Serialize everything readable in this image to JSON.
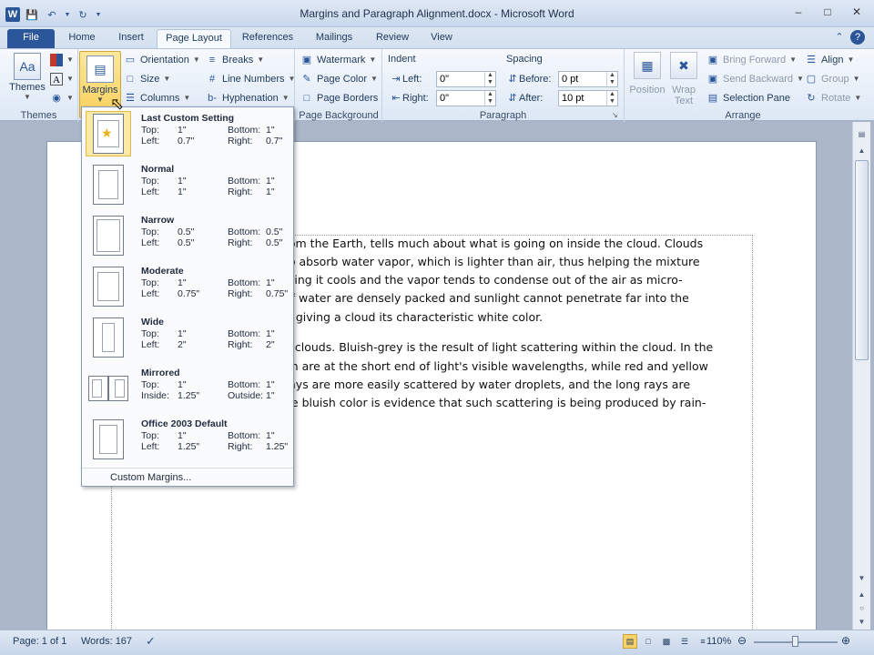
{
  "window": {
    "title": "Margins and Paragraph Alignment.docx - Microsoft Word"
  },
  "tabs": [
    "File",
    "Home",
    "Insert",
    "Page Layout",
    "References",
    "Mailings",
    "Review",
    "View"
  ],
  "active_tab": "Page Layout",
  "ribbon": {
    "themes": {
      "label": "Themes",
      "group": "Themes"
    },
    "margins": {
      "label": "Margins"
    },
    "page_setup": {
      "orientation": "Orientation",
      "size": "Size",
      "columns": "Columns",
      "breaks": "Breaks",
      "line_numbers": "Line Numbers",
      "hyphenation": "Hyphenation"
    },
    "page_background": {
      "group": "Page Background",
      "watermark": "Watermark",
      "page_color": "Page Color",
      "page_borders": "Page Borders"
    },
    "paragraph": {
      "group": "Paragraph",
      "indent": "Indent",
      "spacing": "Spacing",
      "left_label": "Left:",
      "right_label": "Right:",
      "before_label": "Before:",
      "after_label": "After:",
      "left_value": "0\"",
      "right_value": "0\"",
      "before_value": "0 pt",
      "after_value": "10 pt"
    },
    "arrange": {
      "group": "Arrange",
      "position": "Position",
      "wrap_text": "Wrap Text",
      "bring_forward": "Bring Forward",
      "send_backward": "Send Backward",
      "selection_pane": "Selection Pane",
      "align": "Align",
      "group_btn": "Group",
      "rotate": "Rotate"
    }
  },
  "margins_menu": {
    "items": [
      {
        "name": "Last Custom Setting",
        "top": "1\"",
        "bottom": "1\"",
        "left": "0.7\"",
        "right": "0.7\"",
        "l_label": "Left:",
        "r_label": "Right:"
      },
      {
        "name": "Normal",
        "top": "1\"",
        "bottom": "1\"",
        "left": "1\"",
        "right": "1\"",
        "l_label": "Left:",
        "r_label": "Right:"
      },
      {
        "name": "Narrow",
        "top": "0.5\"",
        "bottom": "0.5\"",
        "left": "0.5\"",
        "right": "0.5\"",
        "l_label": "Left:",
        "r_label": "Right:"
      },
      {
        "name": "Moderate",
        "top": "1\"",
        "bottom": "1\"",
        "left": "0.75\"",
        "right": "0.75\"",
        "l_label": "Left:",
        "r_label": "Right:"
      },
      {
        "name": "Wide",
        "top": "1\"",
        "bottom": "1\"",
        "left": "2\"",
        "right": "2\"",
        "l_label": "Left:",
        "r_label": "Right:"
      },
      {
        "name": "Mirrored",
        "top": "1\"",
        "bottom": "1\"",
        "left": "1.25\"",
        "right": "1\"",
        "l_label": "Inside:",
        "r_label": "Outside:"
      },
      {
        "name": "Office 2003 Default",
        "top": "1\"",
        "bottom": "1\"",
        "left": "1.25\"",
        "right": "1.25\"",
        "l_label": "Left:",
        "r_label": "Right:"
      }
    ],
    "top_label": "Top:",
    "bottom_label": "Bottom:",
    "custom": "Custom Margins..."
  },
  "document": {
    "lines": [
      "rom the Earth, tells much about what is going on inside the cloud. Clouds",
      "to absorb water vapor, which is lighter than air, thus helping the mixture",
      "ining it cools and the vapor tends to condense out of the air as micro-",
      "of water are densely packed and sunlight cannot penetrate far into the",
      "t, giving a cloud its characteristic white color.",
      "n clouds. Bluish-grey is the result of light scattering within the cloud. In the",
      "en are at the short end of light's visible wavelengths, while red and yellow",
      "rays are more easily scattered by water droplets, and the long rays are",
      "he bluish color is evidence that such scattering is being produced by rain-"
    ]
  },
  "status": {
    "page": "Page: 1 of 1",
    "words": "Words: 167",
    "zoom": "110%"
  }
}
